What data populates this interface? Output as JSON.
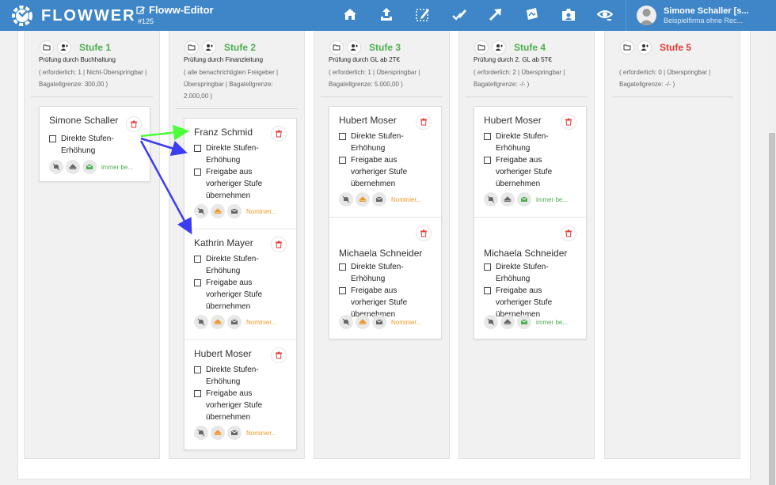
{
  "app": {
    "logo_text": "FLOWWER",
    "editor_title": "Floww-Editor",
    "editor_id": "#125"
  },
  "nav": {
    "icons": [
      "home-icon",
      "upload-icon",
      "select-area-icon",
      "edit-check-icon",
      "arrow-up-right-icon",
      "image-edit-icon",
      "user-badge-icon",
      "eye-refresh-icon"
    ]
  },
  "user": {
    "name": "Simone Schaller [s...",
    "company": "Beispielfirma ohne Rec..."
  },
  "colors": {
    "topbar": "#3e86c8",
    "stage_green": "#4caf50",
    "stage_red": "#e53935",
    "trash_red": "#e53935",
    "arrow_green": "#4cff3a",
    "arrow_blue": "#3c3cf0",
    "text_orange": "#ef9a2c"
  },
  "labels": {
    "direct_increase": "Direkte Stufen-Erhöhung",
    "accept_previous": "Freigabe aus vorheriger Stufe übernehmen",
    "always_notify": "immer be...",
    "nominated": "Nominier..."
  },
  "stages": [
    {
      "title": "Stufe 1",
      "description": "Prüfung durch Buchhaltung",
      "meta": "( erforderlich: 1 | Nicht-Überspringbar | Bagatellgrenze: 300,00 )",
      "cards": [
        {
          "name": "Simone Schaller",
          "notify": "immer be..."
        }
      ]
    },
    {
      "title": "Stufe 2",
      "description": "Prüfung durch Finanzleitung",
      "meta": "( alle benachrichtigten Freigeber | Überspringbar | Bagatellgrenze: 2.000,00 )",
      "cards": [
        {
          "name": "Franz Schmid",
          "notify": "Nominier..."
        },
        {
          "name": "Kathrin Mayer",
          "notify": "Nominier..."
        },
        {
          "name": "Hubert Moser",
          "notify": "Nominier..."
        }
      ]
    },
    {
      "title": "Stufe 3",
      "description": "Prüfung durch GL ab 2T€",
      "meta": "( erforderlich: 1 | Überspringbar | Bagatellgrenze: 5.000,00 )",
      "cards": [
        {
          "name": "Hubert Moser",
          "notify": "Nominier..."
        },
        {
          "name": "Michaela Schneider",
          "notify": "Nominier..."
        }
      ]
    },
    {
      "title": "Stufe 4",
      "description": "Prüfung durch 2. GL ab 5T€",
      "meta": "( erforderlich: 2 | Überspringbar | Bagatellgrenze: -/- )",
      "cards": [
        {
          "name": "Hubert Moser",
          "notify": "immer be..."
        },
        {
          "name": "Michaela Schneider",
          "notify": "immer be..."
        }
      ]
    },
    {
      "title": "Stufe 5",
      "description": "",
      "meta": "( erforderlich: 0 | Überspringbar | Bagatellgrenze: -/- )",
      "cards": []
    }
  ]
}
